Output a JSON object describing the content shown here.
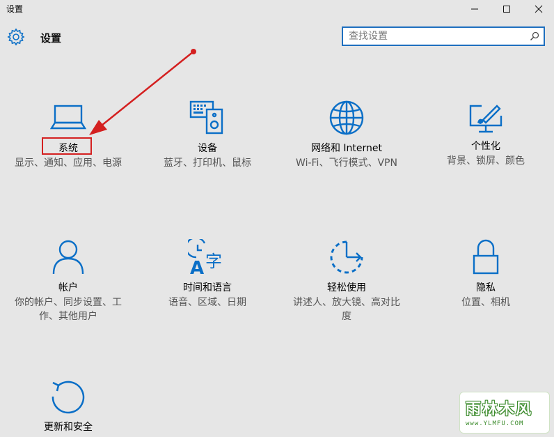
{
  "window": {
    "title": "设置",
    "minimize": "—",
    "maximize": "☐",
    "close": "✕"
  },
  "header": {
    "title": "设置",
    "icon": "gear-icon"
  },
  "search": {
    "placeholder": "查找设置",
    "icon": "search-icon"
  },
  "accent_color": "#0b6fc7",
  "tiles": [
    {
      "title": "系统",
      "desc": "显示、通知、应用、电源",
      "icon": "laptop-icon"
    },
    {
      "title": "设备",
      "desc": "蓝牙、打印机、鼠标",
      "icon": "devices-icon"
    },
    {
      "title": "网络和 Internet",
      "desc": "Wi-Fi、飞行模式、VPN",
      "icon": "globe-icon"
    },
    {
      "title": "个性化",
      "desc": "背景、锁屏、颜色",
      "icon": "personalize-icon"
    },
    {
      "title": "帐户",
      "desc": "你的帐户、同步设置、工作、其他用户",
      "icon": "person-icon"
    },
    {
      "title": "时间和语言",
      "desc": "语音、区域、日期",
      "icon": "time-language-icon"
    },
    {
      "title": "轻松使用",
      "desc": "讲述人、放大镜、高对比度",
      "icon": "ease-of-access-icon"
    },
    {
      "title": "隐私",
      "desc": "位置、相机",
      "icon": "lock-icon"
    },
    {
      "title": "更新和安全",
      "desc": "",
      "icon": "refresh-icon"
    }
  ],
  "watermark": {
    "text": "雨林木风",
    "url": "www.YLMFU.COM"
  }
}
